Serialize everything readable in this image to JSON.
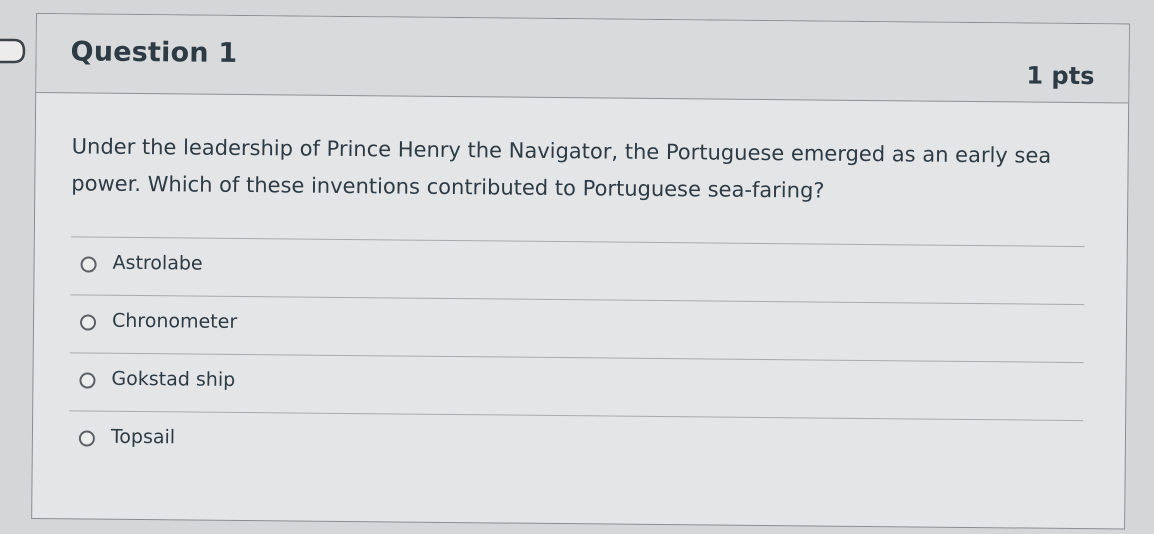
{
  "question": {
    "title": "Question 1",
    "points": "1 pts",
    "text": "Under the leadership of Prince Henry the Navigator, the Portuguese emerged as an early sea power. Which of these inventions contributed to Portuguese sea-faring?",
    "answers": [
      {
        "label": "Astrolabe",
        "selected": false
      },
      {
        "label": "Chronometer",
        "selected": false
      },
      {
        "label": "Gokstad ship",
        "selected": false
      },
      {
        "label": "Topsail",
        "selected": false
      }
    ]
  },
  "colors": {
    "text": "#2d3b45",
    "header_bg": "#d9dadb",
    "body_bg": "#e4e5e6",
    "border": "#8a8d90"
  },
  "icons": {
    "flag": "question-flag-icon",
    "radio": "radio-unchecked-icon"
  }
}
